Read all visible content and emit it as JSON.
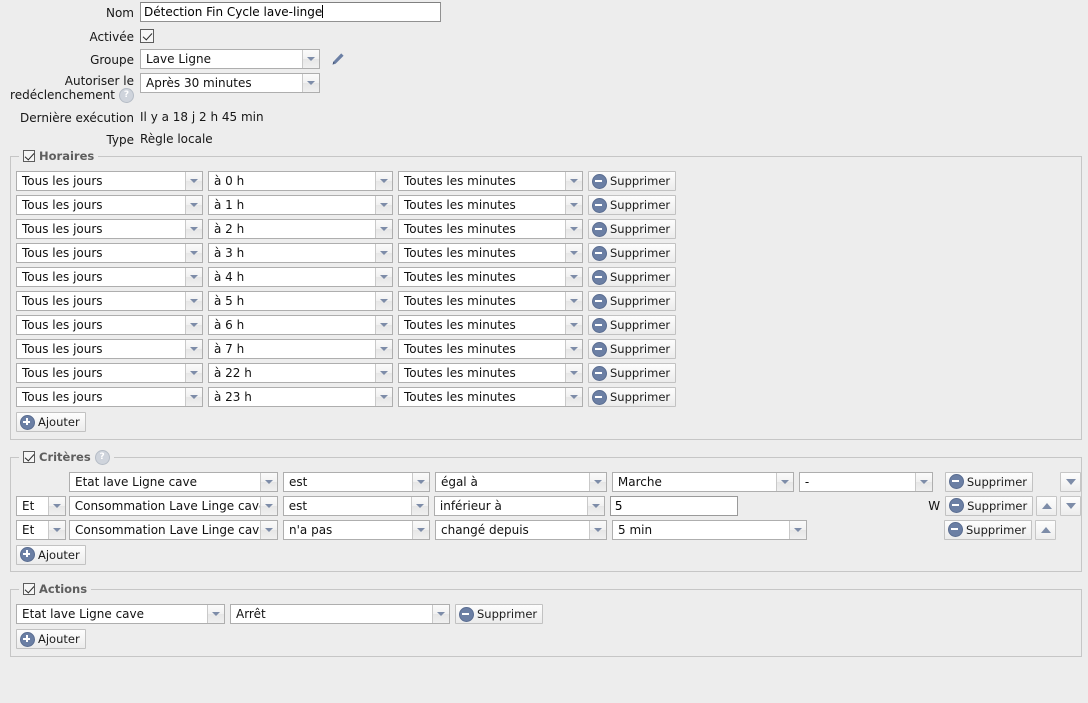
{
  "form": {
    "nom": {
      "label": "Nom",
      "value": "Détection Fin Cycle lave-linge"
    },
    "activee": {
      "label": "Activée",
      "checked": true
    },
    "groupe": {
      "label": "Groupe",
      "value": "Lave Ligne",
      "edit_icon": "pencil-icon"
    },
    "redeclenchement": {
      "label_line1": "Autoriser le",
      "label_line2": "redéclenchement",
      "value": "Après 30 minutes",
      "help": "?"
    },
    "derniere_execution": {
      "label": "Dernière exécution",
      "value": "Il y a 18 j 2 h 45 min"
    },
    "type": {
      "label": "Type",
      "value": "Règle locale"
    }
  },
  "horaires": {
    "legend": "Horaires",
    "checked": true,
    "add_label": "Ajouter",
    "delete_label": "Supprimer",
    "rows": [
      {
        "jour": "Tous les jours",
        "heure": "à 0 h",
        "minute": "Toutes les minutes"
      },
      {
        "jour": "Tous les jours",
        "heure": "à 1 h",
        "minute": "Toutes les minutes"
      },
      {
        "jour": "Tous les jours",
        "heure": "à 2 h",
        "minute": "Toutes les minutes"
      },
      {
        "jour": "Tous les jours",
        "heure": "à 3 h",
        "minute": "Toutes les minutes"
      },
      {
        "jour": "Tous les jours",
        "heure": "à 4 h",
        "minute": "Toutes les minutes"
      },
      {
        "jour": "Tous les jours",
        "heure": "à 5 h",
        "minute": "Toutes les minutes"
      },
      {
        "jour": "Tous les jours",
        "heure": "à 6 h",
        "minute": "Toutes les minutes"
      },
      {
        "jour": "Tous les jours",
        "heure": "à 7 h",
        "minute": "Toutes les minutes"
      },
      {
        "jour": "Tous les jours",
        "heure": "à 22 h",
        "minute": "Toutes les minutes"
      },
      {
        "jour": "Tous les jours",
        "heure": "à 23 h",
        "minute": "Toutes les minutes"
      }
    ]
  },
  "criteres": {
    "legend": "Critères",
    "checked": true,
    "help": "?",
    "add_label": "Ajouter",
    "delete_label": "Supprimer",
    "rows": [
      {
        "operateur": "",
        "source": "Etat lave Ligne cave",
        "verbe": "est",
        "comparateur": "égal à",
        "valeur": "Marche",
        "valeur_is_select": true,
        "extra": "-",
        "extra_is_select": true,
        "unit": "",
        "move_up": false,
        "move_down": true
      },
      {
        "operateur": "Et",
        "source": "Consommation Lave Linge cave",
        "verbe": "est",
        "comparateur": "inférieur à",
        "valeur": "5",
        "valeur_is_select": false,
        "extra": "",
        "extra_is_select": false,
        "unit": "W",
        "move_up": true,
        "move_down": true
      },
      {
        "operateur": "Et",
        "source": "Consommation Lave Linge cave",
        "verbe": "n'a pas",
        "comparateur": "changé depuis",
        "valeur": "5 min",
        "valeur_is_select": true,
        "extra": "",
        "extra_is_select": false,
        "unit": "",
        "move_up": true,
        "move_down": false
      }
    ]
  },
  "actions": {
    "legend": "Actions",
    "checked": true,
    "add_label": "Ajouter",
    "delete_label": "Supprimer",
    "rows": [
      {
        "cible": "Etat lave Ligne cave",
        "commande": "Arrêt"
      }
    ]
  },
  "colors": {
    "background": "#ededed",
    "accent": "#6b7fa4",
    "border": "#c6c6c6",
    "legend_text": "#5e5e5e"
  }
}
